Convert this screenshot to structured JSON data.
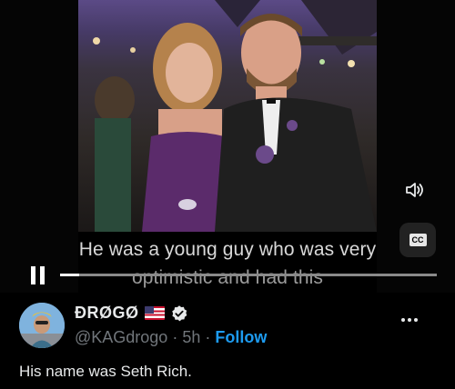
{
  "video": {
    "captions": {
      "line1": "He was a young guy who was very",
      "line2": "optimistic and had this"
    },
    "cc_label": "CC",
    "progress_fraction": 0.05,
    "icons": [
      "pause-icon",
      "volume-icon",
      "closed-captions-icon"
    ]
  },
  "tweet": {
    "display_name": "ÐRØGØ",
    "handle": "@KAGdrogo",
    "separator": "·",
    "time": "5h",
    "follow_label": "Follow",
    "text": "His name was Seth Rich."
  },
  "colors": {
    "background": "#000000",
    "accent": "#1d9bf0",
    "secondary_text": "#71767b",
    "primary_text": "#e7e9ea"
  }
}
